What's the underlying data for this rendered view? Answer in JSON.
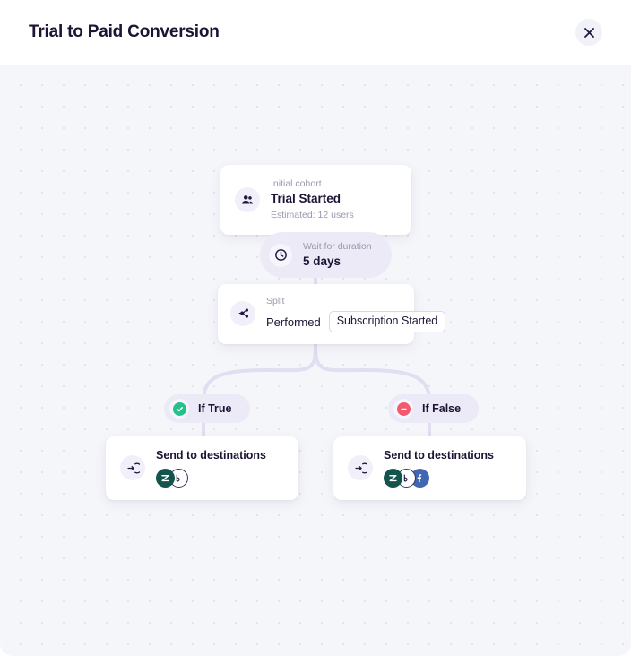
{
  "header": {
    "title": "Trial to Paid Conversion",
    "close_label": "×",
    "close_icon": "close-icon"
  },
  "canvas": {
    "background_color": "#f5f6fa",
    "dot_color": "#e2e3ec",
    "edge_color": "#e0def0"
  },
  "flow": {
    "nodes": {
      "cohort": {
        "icon": "users-icon",
        "kicker": "Initial cohort",
        "title": "Trial Started",
        "subtitle": "Estimated: 12 users"
      },
      "wait": {
        "icon": "clock-icon",
        "kicker": "Wait for duration",
        "title": "5 days"
      },
      "split": {
        "icon": "split-branch-icon",
        "kicker": "Split",
        "verb": "Performed",
        "condition": "Subscription Started"
      },
      "if_true": {
        "icon": "check-circle-icon",
        "label": "If True",
        "badge_color": "#27c08a"
      },
      "if_false": {
        "icon": "minus-circle-icon",
        "label": "If False",
        "badge_color": "#f15b6c"
      },
      "destinations_true": {
        "icon": "send-to-icon",
        "title": "Send to destinations",
        "integrations": [
          {
            "name": "zendesk-icon",
            "glyph": "Z",
            "color": "#13544d"
          },
          {
            "name": "braze-icon",
            "glyph": "b",
            "color": "#ffffff"
          }
        ]
      },
      "destinations_false": {
        "icon": "send-to-icon",
        "title": "Send to destinations",
        "integrations": [
          {
            "name": "zendesk-icon",
            "glyph": "Z",
            "color": "#13544d"
          },
          {
            "name": "braze-icon",
            "glyph": "b",
            "color": "#ffffff"
          },
          {
            "name": "facebook-icon",
            "glyph": "f",
            "color": "#4267b2"
          }
        ]
      }
    }
  }
}
